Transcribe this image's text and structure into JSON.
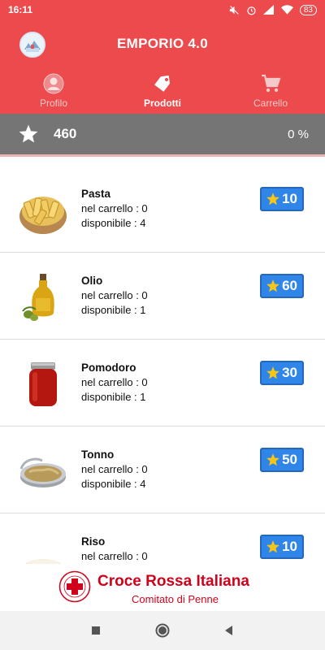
{
  "status_bar": {
    "time": "16:11",
    "battery": "83"
  },
  "header": {
    "title": "EMPORIO 4.0",
    "logo_icon": "emporio-logo",
    "tabs": [
      {
        "label": "Profilo",
        "icon": "person-icon",
        "active": false
      },
      {
        "label": "Prodotti",
        "icon": "tag-icon",
        "active": true
      },
      {
        "label": "Carrello",
        "icon": "cart-icon",
        "active": false
      }
    ]
  },
  "score": {
    "points": "460",
    "percent": "0 %"
  },
  "products": [
    {
      "name": "Pasta",
      "cart_line": "nel carrello : 0",
      "avail_line": "disponibile : 4",
      "price": "10"
    },
    {
      "name": "Olio",
      "cart_line": "nel carrello : 0",
      "avail_line": "disponibile : 1",
      "price": "60"
    },
    {
      "name": "Pomodoro",
      "cart_line": "nel carrello : 0",
      "avail_line": "disponibile : 1",
      "price": "30"
    },
    {
      "name": "Tonno",
      "cart_line": "nel carrello : 0",
      "avail_line": "disponibile : 4",
      "price": "50"
    },
    {
      "name": "Riso",
      "cart_line": "nel carrello : 0",
      "avail_line": "",
      "price": "10"
    }
  ],
  "footer": {
    "org": "Croce Rossa Italiana",
    "branch": "Comitato di Penne"
  },
  "colors": {
    "primary": "#ec4a4c",
    "score_bar": "#757575",
    "badge": "#2f86e8",
    "star": "#f5c518",
    "cri_red": "#d0021b"
  }
}
